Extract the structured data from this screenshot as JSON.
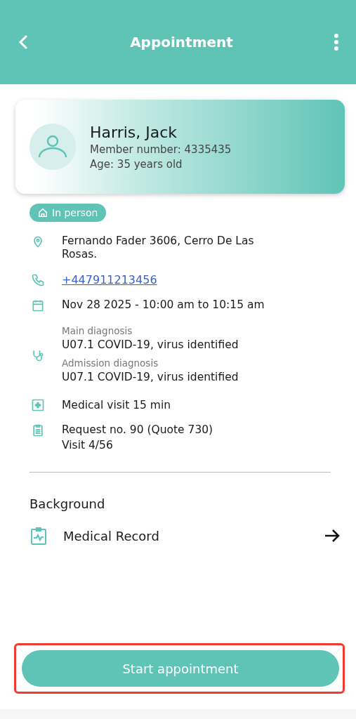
{
  "header": {
    "title": "Appointment"
  },
  "patient": {
    "name": "Harris, Jack",
    "member": "Member number: 4335435",
    "age": "Age: 35 years old"
  },
  "badge": {
    "label": "In person"
  },
  "details": [
    {
      "kind": "address",
      "lines": [
        "Fernando Fader 3606, Cerro De Las Rosas."
      ]
    },
    {
      "kind": "phone",
      "link": "+447911213456"
    },
    {
      "kind": "date",
      "lines": [
        "Nov 28 2025 - 10:00 am to 10:15 am"
      ]
    },
    {
      "kind": "diagnosis",
      "groups": [
        {
          "label": "Main diagnosis",
          "value": "U07.1 COVID-19, virus identified"
        },
        {
          "label": "Admission diagnosis",
          "value": "U07.1 COVID-19, virus identified"
        }
      ]
    },
    {
      "kind": "visit",
      "lines": [
        "Medical visit 15 min"
      ]
    },
    {
      "kind": "request",
      "lines": [
        "Request no. 90 (Quote 730)",
        "Visit 4/56"
      ]
    }
  ],
  "background": {
    "title": "Background",
    "items": [
      {
        "label": "Medical Record"
      }
    ]
  },
  "action": {
    "label": "Start appointment",
    "highlighted": true
  }
}
